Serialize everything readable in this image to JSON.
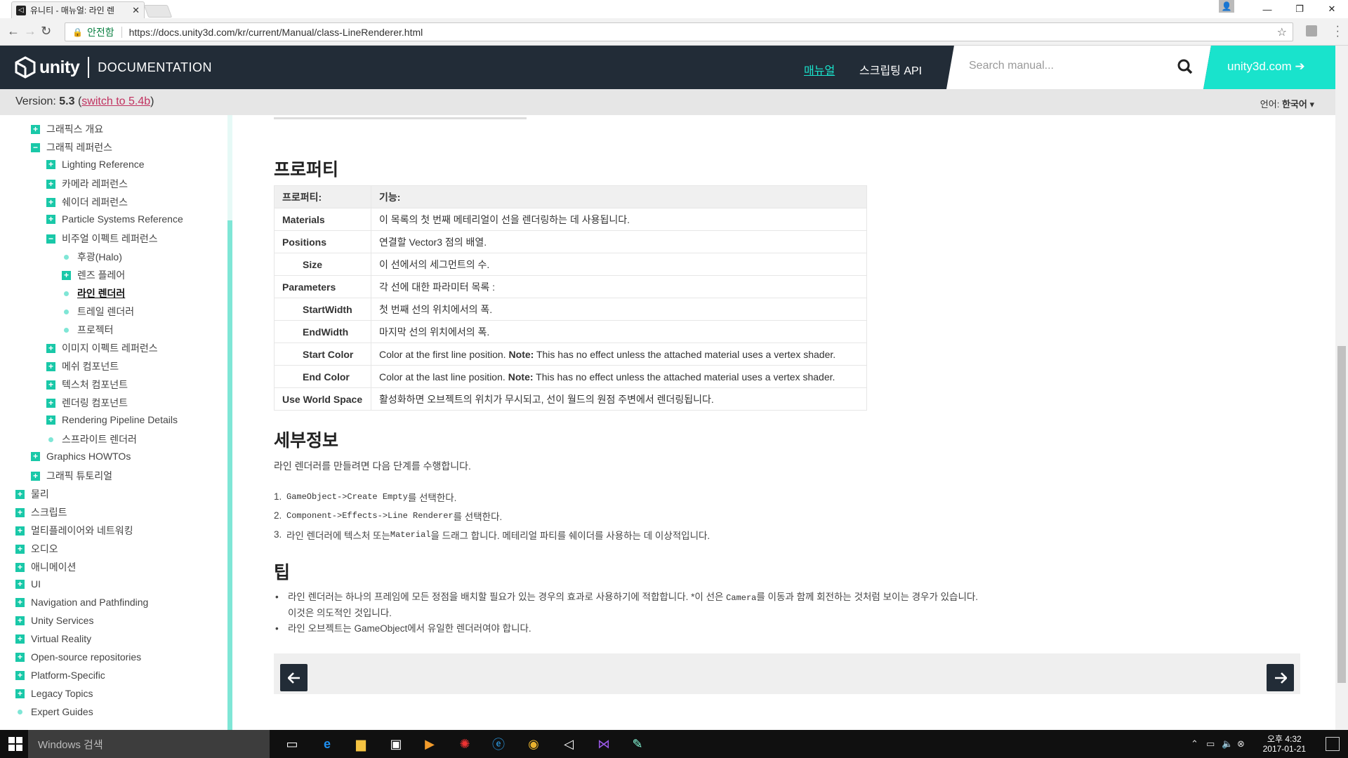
{
  "browser": {
    "tab_title": "유니티 - 매뉴얼: 라인 렌",
    "secure_label": "안전함",
    "url": "https://docs.unity3d.com/kr/current/Manual/class-LineRenderer.html"
  },
  "header": {
    "logo_text": "unity",
    "doc_label": "DOCUMENTATION",
    "nav_manual": "매뉴얼",
    "nav_api": "스크립팅 API",
    "search_placeholder": "Search manual...",
    "site_link": "unity3d.com",
    "accent_color": "#19e3cc",
    "bg_color": "#222c37"
  },
  "version_bar": {
    "prefix": "Version: ",
    "version": "5.3",
    "open": " (",
    "switch_link": "switch to 5.4b",
    "close": ")",
    "lang_label": "언어:",
    "lang_value": "한국어"
  },
  "sidebar": {
    "items": [
      {
        "label": "그래픽스 개요",
        "marker": "plus",
        "level": 1
      },
      {
        "label": "그래픽 레퍼런스",
        "marker": "minus",
        "level": 1
      },
      {
        "label": "Lighting Reference",
        "marker": "plus",
        "level": 2
      },
      {
        "label": "카메라 레퍼런스",
        "marker": "plus",
        "level": 2
      },
      {
        "label": "쉐이더 레퍼런스",
        "marker": "plus",
        "level": 2
      },
      {
        "label": "Particle Systems Reference",
        "marker": "plus",
        "level": 2
      },
      {
        "label": "비주얼 이펙트 레퍼런스",
        "marker": "minus",
        "level": 2
      },
      {
        "label": "후광(Halo)",
        "marker": "dot",
        "level": 3
      },
      {
        "label": "렌즈 플레어",
        "marker": "plus",
        "level": 3
      },
      {
        "label": "라인 렌더러",
        "marker": "dot",
        "level": 3,
        "active": true
      },
      {
        "label": "트레일 렌더러",
        "marker": "dot",
        "level": 3
      },
      {
        "label": "프로젝터",
        "marker": "dot",
        "level": 3
      },
      {
        "label": "이미지 이펙트 레퍼런스",
        "marker": "plus",
        "level": 2
      },
      {
        "label": "메쉬 컴포넌트",
        "marker": "plus",
        "level": 2
      },
      {
        "label": "텍스처 컴포넌트",
        "marker": "plus",
        "level": 2
      },
      {
        "label": "렌더링 컴포넌트",
        "marker": "plus",
        "level": 2
      },
      {
        "label": "Rendering Pipeline Details",
        "marker": "plus",
        "level": 2
      },
      {
        "label": "스프라이트 렌더러",
        "marker": "dot",
        "level": 2
      },
      {
        "label": "Graphics HOWTOs",
        "marker": "plus",
        "level": 1
      },
      {
        "label": "그래픽 튜토리얼",
        "marker": "plus",
        "level": 1
      },
      {
        "label": "물리",
        "marker": "plus",
        "level": 0
      },
      {
        "label": "스크립트",
        "marker": "plus",
        "level": 0
      },
      {
        "label": "멀티플레이어와 네트워킹",
        "marker": "plus",
        "level": 0
      },
      {
        "label": "오디오",
        "marker": "plus",
        "level": 0
      },
      {
        "label": "애니메이션",
        "marker": "plus",
        "level": 0
      },
      {
        "label": "UI",
        "marker": "plus",
        "level": 0
      },
      {
        "label": "Navigation and Pathfinding",
        "marker": "plus",
        "level": 0
      },
      {
        "label": "Unity Services",
        "marker": "plus",
        "level": 0
      },
      {
        "label": "Virtual Reality",
        "marker": "plus",
        "level": 0
      },
      {
        "label": "Open-source repositories",
        "marker": "plus",
        "level": 0
      },
      {
        "label": "Platform-Specific",
        "marker": "plus",
        "level": 0
      },
      {
        "label": "Legacy Topics",
        "marker": "plus",
        "level": 0
      },
      {
        "label": "Expert Guides",
        "marker": "dot",
        "level": 0
      }
    ]
  },
  "content": {
    "props_heading": "프로퍼티",
    "table_header": [
      "프로퍼티:",
      "기능:"
    ],
    "rows": [
      {
        "name": "Materials",
        "desc": "이 목록의 첫 번째 메테리얼이 선을 렌더링하는 데 사용됩니다.",
        "sub": false
      },
      {
        "name": "Positions",
        "desc": "연결할 Vector3 점의 배열.",
        "sub": false
      },
      {
        "name": "Size",
        "desc": "이 선에서의 세그먼트의 수.",
        "sub": true
      },
      {
        "name": "Parameters",
        "desc": "각 선에 대한 파라미터 목록 :",
        "sub": false
      },
      {
        "name": "StartWidth",
        "desc": "첫 번째 선의 위치에서의 폭.",
        "sub": true
      },
      {
        "name": "EndWidth",
        "desc": "마지막 선의 위치에서의 폭.",
        "sub": true
      },
      {
        "name": "Start Color",
        "desc": "Color at the first line position.",
        "note": "Note:",
        "desc2": " This has no effect unless the attached material uses a vertex shader.",
        "sub": true
      },
      {
        "name": "End Color",
        "desc": "Color at the last line position.",
        "note": "Note:",
        "desc2": " This has no effect unless the attached material uses a vertex shader.",
        "sub": true
      },
      {
        "name": "Use World Space",
        "desc": "활성화하면 오브젝트의 위치가 무시되고, 선이 월드의 원점 주변에서 렌더링됩니다.",
        "sub": false
      }
    ],
    "details_heading": "세부정보",
    "details_intro": "라인 렌더러를 만들려면 다음 단계를 수행합니다.",
    "steps": [
      {
        "num": "1.",
        "code": "GameObject->Create Empty",
        "text": "를 선택한다."
      },
      {
        "num": "2.",
        "code": "Component->Effects->Line Renderer",
        "text": "를 선택한다."
      },
      {
        "num": "3.",
        "pre": "라인 렌더러에 텍스처 또는 ",
        "code": "Material",
        "text": "을 드래그 합니다. 메테리얼 파티를 쉐이더를 사용하는 데 이상적입니다."
      }
    ],
    "tips_heading": "팁",
    "tip1_a": "라인 렌더러는 하나의 프레임에 모든 정점을 배치할 필요가 있는 경우의 효과로 사용하기에 적합합니다. *이 선은 ",
    "tip1_code": "Camera",
    "tip1_b": "를 이동과 함께 회전하는 것처럼 보이는 경우가 있습니다.",
    "tip1_c": "이것은 의도적인 것입니다.",
    "tip2": "라인 오브젝트는 GameObject에서 유일한 렌더러여야 합니다."
  },
  "taskbar": {
    "search_placeholder": "Windows 검색",
    "time": "오후 4:32",
    "date": "2017-01-21"
  }
}
